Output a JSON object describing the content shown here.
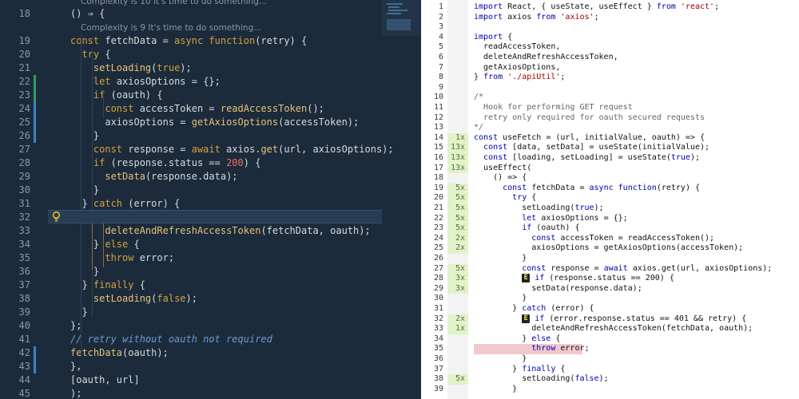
{
  "editor": {
    "lenses": [
      {
        "text": "Complexity is 10 It's time to do something..."
      },
      {
        "text": "Complexity is 9 It's time to do something..."
      }
    ],
    "lines": [
      {
        "n": "18",
        "code": "() ⇒ {"
      },
      {
        "n": "19",
        "code": "const fetchData = async function(retry) {"
      },
      {
        "n": "20",
        "code": "  try {"
      },
      {
        "n": "21",
        "code": "    setLoading(true);"
      },
      {
        "n": "22",
        "code": "    let axiosOptions = {};"
      },
      {
        "n": "23",
        "code": "    if (oauth) {"
      },
      {
        "n": "24",
        "code": "      const accessToken = readAccessToken();"
      },
      {
        "n": "25",
        "code": "      axiosOptions = getAxiosOptions(accessToken);"
      },
      {
        "n": "26",
        "code": "    }"
      },
      {
        "n": "27",
        "code": "    const response = await axios.get(url, axiosOptions);"
      },
      {
        "n": "28",
        "code": "    if (response.status == 200) {"
      },
      {
        "n": "29",
        "code": "      setData(response.data);"
      },
      {
        "n": "30",
        "code": "    }"
      },
      {
        "n": "31",
        "code": "  } catch (error) {"
      },
      {
        "n": "32",
        "code": "    if (error.response.status == 401 && retry) {"
      },
      {
        "n": "33",
        "code": "      deleteAndRefreshAccessToken(fetchData, oauth);"
      },
      {
        "n": "34",
        "code": "    } else {"
      },
      {
        "n": "35",
        "code": "      throw error;"
      },
      {
        "n": "36",
        "code": "    }"
      },
      {
        "n": "37",
        "code": "  } finally {"
      },
      {
        "n": "38",
        "code": "    setLoading(false);"
      },
      {
        "n": "39",
        "code": "  }"
      },
      {
        "n": "40",
        "code": "};"
      },
      {
        "n": "41",
        "code": "// retry without oauth not required"
      },
      {
        "n": "42",
        "code": "fetchData(oauth);"
      },
      {
        "n": "43",
        "code": "},"
      },
      {
        "n": "44",
        "code": "[oauth, url]"
      },
      {
        "n": "45",
        "code": ");"
      }
    ],
    "colors": {
      "background": "#1c2b3b",
      "keyword": "#d2a23b",
      "function": "#e5c07b",
      "string": "#e0604d",
      "comment": "#6c9bd1",
      "change_bar": "#2f9e6a",
      "change_bar_mod": "#3b82c4"
    }
  },
  "report": {
    "badge": "E",
    "lines": [
      {
        "n": "1",
        "cnt": "",
        "code": "import React, { useState, useEffect } from 'react';"
      },
      {
        "n": "2",
        "cnt": "",
        "code": "import axios from 'axios';"
      },
      {
        "n": "3",
        "cnt": "",
        "code": ""
      },
      {
        "n": "4",
        "cnt": "",
        "code": "import {"
      },
      {
        "n": "5",
        "cnt": "",
        "code": "  readAccessToken,"
      },
      {
        "n": "6",
        "cnt": "",
        "code": "  deleteAndRefreshAccessToken,"
      },
      {
        "n": "7",
        "cnt": "",
        "code": "  getAxiosOptions,"
      },
      {
        "n": "8",
        "cnt": "",
        "code": "} from './apiUtil';"
      },
      {
        "n": "9",
        "cnt": "",
        "code": ""
      },
      {
        "n": "10",
        "cnt": "",
        "code": "/*"
      },
      {
        "n": "11",
        "cnt": "",
        "code": "  Hook for performing GET request"
      },
      {
        "n": "12",
        "cnt": "",
        "code": "  retry only required for oauth secured requests"
      },
      {
        "n": "13",
        "cnt": "",
        "code": "*/"
      },
      {
        "n": "14",
        "cnt": "1x",
        "code": "const useFetch = (url, initialValue, oauth) => {"
      },
      {
        "n": "15",
        "cnt": "13x",
        "code": "  const [data, setData] = useState(initialValue);"
      },
      {
        "n": "16",
        "cnt": "13x",
        "code": "  const [loading, setLoading] = useState(true);"
      },
      {
        "n": "17",
        "cnt": "13x",
        "code": "  useEffect("
      },
      {
        "n": "18",
        "cnt": "",
        "code": "    () => {"
      },
      {
        "n": "19",
        "cnt": "5x",
        "code": "      const fetchData = async function(retry) {"
      },
      {
        "n": "20",
        "cnt": "5x",
        "code": "        try {"
      },
      {
        "n": "21",
        "cnt": "5x",
        "code": "          setLoading(true);"
      },
      {
        "n": "22",
        "cnt": "5x",
        "code": "          let axiosOptions = {};"
      },
      {
        "n": "23",
        "cnt": "5x",
        "code": "          if (oauth) {"
      },
      {
        "n": "24",
        "cnt": "2x",
        "code": "            const accessToken = readAccessToken();"
      },
      {
        "n": "25",
        "cnt": "2x",
        "code": "            axiosOptions = getAxiosOptions(accessToken);"
      },
      {
        "n": "26",
        "cnt": "",
        "code": "          }"
      },
      {
        "n": "27",
        "cnt": "5x",
        "code": "          const response = await axios.get(url, axiosOptions);"
      },
      {
        "n": "28",
        "cnt": "3x",
        "code": "          E if (response.status == 200) {"
      },
      {
        "n": "29",
        "cnt": "3x",
        "code": "            setData(response.data);"
      },
      {
        "n": "30",
        "cnt": "",
        "code": "          }"
      },
      {
        "n": "31",
        "cnt": "",
        "code": "        } catch (error) {"
      },
      {
        "n": "32",
        "cnt": "2x",
        "code": "          E if (error.response.status == 401 && retry) {"
      },
      {
        "n": "33",
        "cnt": "1x",
        "code": "            deleteAndRefreshAccessToken(fetchData, oauth);"
      },
      {
        "n": "34",
        "cnt": "",
        "code": "          } else {"
      },
      {
        "n": "35",
        "cnt": "",
        "code": "            throw error;"
      },
      {
        "n": "36",
        "cnt": "",
        "code": "          }"
      },
      {
        "n": "37",
        "cnt": "",
        "code": "        } finally {"
      },
      {
        "n": "38",
        "cnt": "5x",
        "code": "          setLoading(false);"
      },
      {
        "n": "39",
        "cnt": "",
        "code": "        }"
      }
    ],
    "colors": {
      "hit": "#e2f2c9",
      "miss": "#f2c1c4",
      "keyword": "#0000ad",
      "string": "#a00000"
    }
  }
}
